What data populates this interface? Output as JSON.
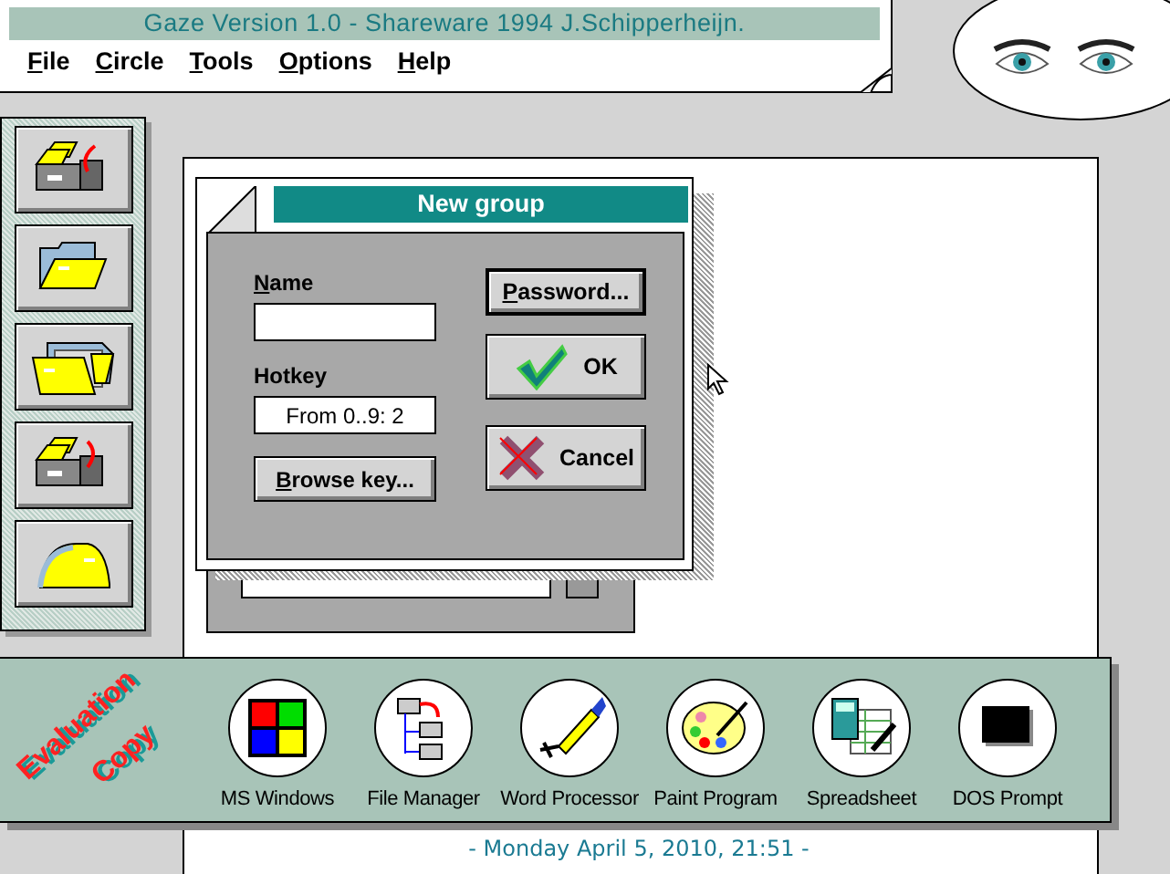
{
  "window": {
    "title": "Gaze Version 1.0 - Shareware 1994 J.Schipperheijn."
  },
  "menu": [
    {
      "label": "File",
      "mnemonic": true
    },
    {
      "label": "Circle",
      "mnemonic": true
    },
    {
      "label": "Tools",
      "mnemonic": true
    },
    {
      "label": "Options",
      "mnemonic": true
    },
    {
      "label": "Help",
      "mnemonic": true
    }
  ],
  "dialog": {
    "title": "New group",
    "fields": [
      {
        "label": "Name",
        "mnemonic": true
      },
      {
        "label": "Hotkey",
        "mnemonic": false,
        "value": "From 0..9: 2"
      }
    ],
    "buttons": [
      {
        "label": "Password...",
        "kind": "plain",
        "mnemonic": true,
        "default": true
      },
      {
        "label": "OK",
        "kind": "ok",
        "mnemonic": false,
        "default": false
      },
      {
        "label": "Cancel",
        "kind": "cancel",
        "mnemonic": false,
        "default": false
      }
    ],
    "browse_button": {
      "label": "Browse key...",
      "mnemonic": true
    }
  },
  "stamp": [
    "Evaluation",
    "Copy"
  ],
  "launcher": [
    {
      "label": "MS Windows",
      "kind": "windows"
    },
    {
      "label": "File Manager",
      "kind": "filemanager"
    },
    {
      "label": "Word Processor",
      "kind": "word"
    },
    {
      "label": "Paint Program",
      "kind": "paint"
    },
    {
      "label": "Spreadsheet",
      "kind": "spreadsheet"
    },
    {
      "label": "DOS Prompt",
      "kind": "dos"
    }
  ],
  "status": "- Monday April 5, 2010, 21:51 -"
}
